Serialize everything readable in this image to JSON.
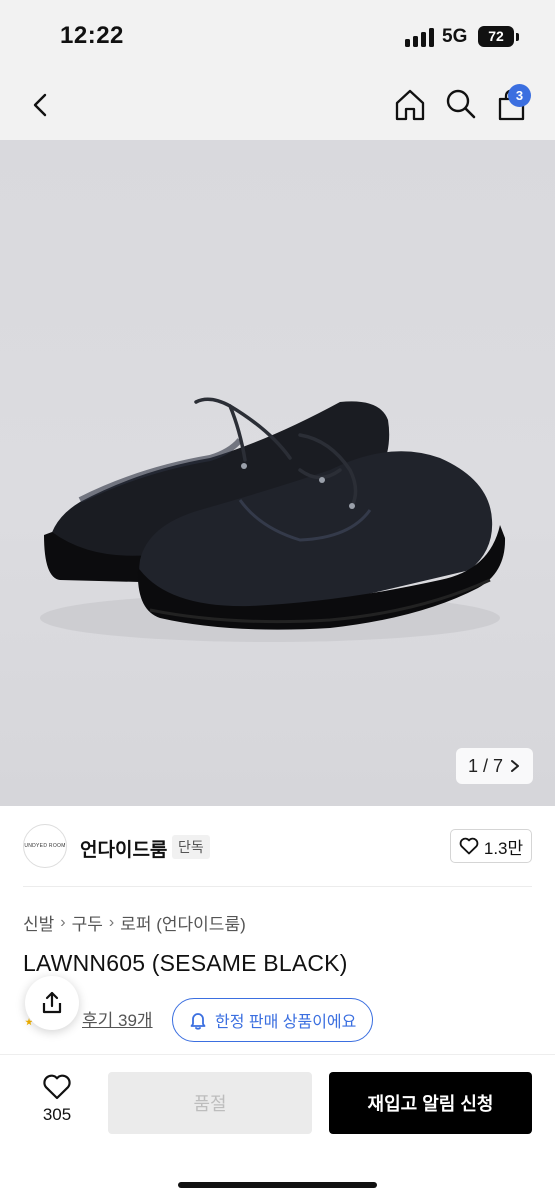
{
  "status_bar": {
    "time": "12:22",
    "network": "5G",
    "battery": "72"
  },
  "nav": {
    "cart_count": "3"
  },
  "gallery": {
    "counter": "1 / 7"
  },
  "brand": {
    "name": "언다이드룸",
    "badge": "단독",
    "logo_text": "UNDYED ROOM",
    "likes": "1.3만"
  },
  "breadcrumb": [
    "신발",
    "구두",
    "로퍼 (언다이드룸)"
  ],
  "product": {
    "title": "LAWNN605 (SESAME BLACK)",
    "reviews": "후기 39개",
    "limited_notice": "한정 판매 상품이에요"
  },
  "bottom": {
    "wish_count": "305",
    "soldout_label": "품절",
    "restock_label": "재입고 알림 신청"
  },
  "colors": {
    "accent": "#3b6fe0",
    "primary_button": "#000000",
    "disabled_button": "#ebebeb"
  }
}
